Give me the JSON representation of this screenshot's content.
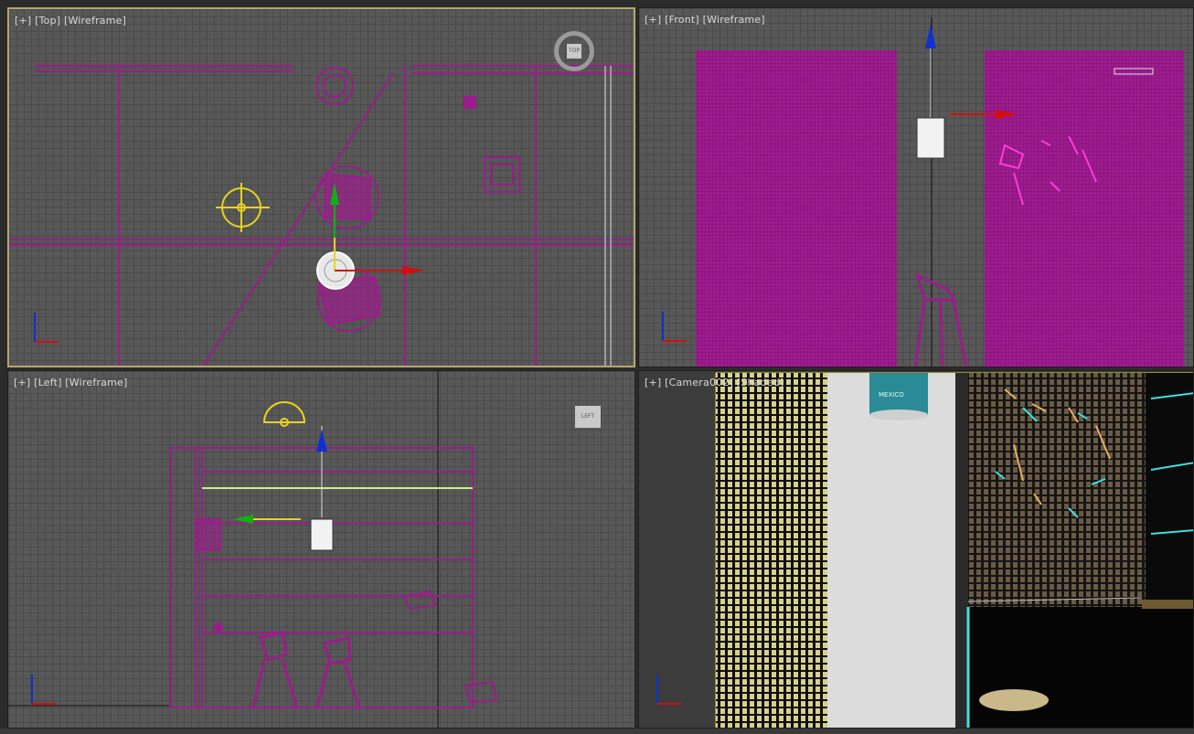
{
  "viewports": {
    "top": {
      "plus": "[+]",
      "view": "[Top]",
      "mode": "[Wireframe]",
      "cube_label": "TOP"
    },
    "front": {
      "plus": "[+]",
      "view": "[Front]",
      "mode": "[Wireframe]"
    },
    "left": {
      "plus": "[+]",
      "view": "[Left]",
      "mode": "[Wireframe]",
      "cube_label": "LEFT"
    },
    "camera": {
      "plus": "[+]",
      "view": "[Camera002]",
      "mode": "[Shaded]",
      "can_text": "MEXICO"
    }
  },
  "axis_labels": {
    "x": "x",
    "y": "y",
    "z": "z"
  },
  "colors": {
    "grid_bg": "#585858",
    "grid_line": "#4b4b4b",
    "wire_magenta": "#9c1c8c",
    "active_border": "#b9a768",
    "light_yellow": "#e6d41c",
    "gizmo_red": "#d01010",
    "gizmo_green": "#10b010",
    "gizmo_blue": "#1030d0",
    "cyan": "#3fe0e0"
  }
}
